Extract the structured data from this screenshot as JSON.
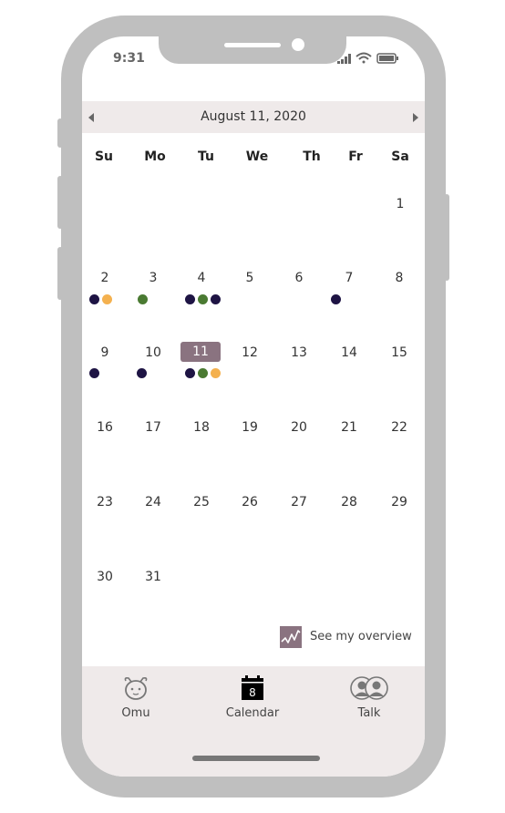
{
  "status": {
    "time": "9:31"
  },
  "calendar": {
    "date_title": "August 11, 2020",
    "weekdays": [
      "Su",
      "Mo",
      "Tu",
      "We",
      "Th",
      "Fr",
      "Sa"
    ],
    "selected_day": "11",
    "days": {
      "d1": "1",
      "d2": "2",
      "d3": "3",
      "d4": "4",
      "d5": "5",
      "d6": "6",
      "d7": "7",
      "d8": "8",
      "d9": "9",
      "d10": "10",
      "d11": "11",
      "d12": "12",
      "d13": "13",
      "d14": "14",
      "d15": "15",
      "d16": "16",
      "d17": "17",
      "d18": "18",
      "d19": "19",
      "d20": "20",
      "d21": "21",
      "d22": "22",
      "d23": "23",
      "d24": "24",
      "d25": "25",
      "d26": "26",
      "d27": "27",
      "d28": "28",
      "d29": "29",
      "d30": "30",
      "d31": "31"
    },
    "event_colors": {
      "navy": "#1e1444",
      "green": "#4a7a32",
      "orange": "#f4b14f"
    },
    "selected_color": "#8a7380"
  },
  "overview": {
    "label": "See my overview",
    "icon": "trend-chart-icon"
  },
  "tabbar": {
    "tabs": [
      {
        "label": "Omu",
        "icon": "omu-mascot-icon"
      },
      {
        "label": "Calendar",
        "icon": "calendar-icon",
        "badge": "8"
      },
      {
        "label": "Talk",
        "icon": "people-icon"
      }
    ]
  }
}
